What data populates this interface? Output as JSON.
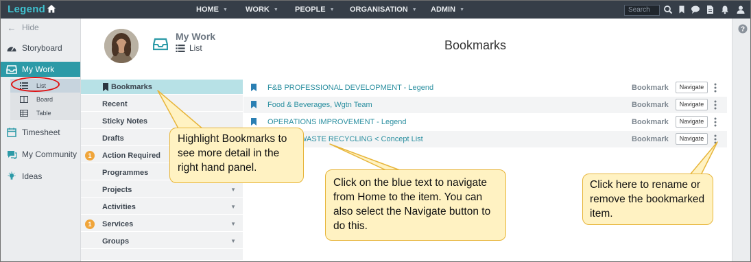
{
  "app": {
    "logo": "Legend"
  },
  "topnav": {
    "items": [
      {
        "label": "HOME"
      },
      {
        "label": "WORK"
      },
      {
        "label": "PEOPLE"
      },
      {
        "label": "ORGANISATION"
      },
      {
        "label": "ADMIN"
      }
    ],
    "search_placeholder": "Search"
  },
  "sidebar": {
    "hide_label": "Hide",
    "items": [
      {
        "label": "Storyboard",
        "icon": "dashboard-icon"
      },
      {
        "label": "My Work",
        "icon": "tray-icon"
      },
      {
        "label": "Timesheet",
        "icon": "calendar-icon"
      },
      {
        "label": "My Community",
        "icon": "chat-icon"
      },
      {
        "label": "Ideas",
        "icon": "lightbulb-icon"
      }
    ],
    "subitems": [
      {
        "label": "List",
        "icon": "list-icon"
      },
      {
        "label": "Board",
        "icon": "columns-icon"
      },
      {
        "label": "Table",
        "icon": "table-icon"
      }
    ]
  },
  "header": {
    "section_title": "My Work",
    "view_label": "List",
    "page_title": "Bookmarks"
  },
  "categories": [
    {
      "label": "Bookmarks",
      "count": "",
      "expandable": false
    },
    {
      "label": "Recent",
      "count": "",
      "expandable": false
    },
    {
      "label": "Sticky Notes",
      "count": "",
      "expandable": false
    },
    {
      "label": "Drafts",
      "count": "",
      "expandable": false
    },
    {
      "label": "Action Required",
      "count": "1",
      "expandable": false
    },
    {
      "label": "Programmes",
      "count": "",
      "expandable": true
    },
    {
      "label": "Projects",
      "count": "",
      "expandable": true
    },
    {
      "label": "Activities",
      "count": "",
      "expandable": true
    },
    {
      "label": "Services",
      "count": "1",
      "expandable": true
    },
    {
      "label": "Groups",
      "count": "",
      "expandable": true
    }
  ],
  "bookmarks": [
    {
      "title": "F&B PROFESSIONAL DEVELOPMENT - Legend",
      "type": "Bookmark",
      "button": "Navigate"
    },
    {
      "title": "Food & Beverages, Wgtn Team",
      "type": "Bookmark",
      "button": "Navigate"
    },
    {
      "title": "OPERATIONS IMPROVEMENT - Legend",
      "type": "Bookmark",
      "button": "Navigate"
    },
    {
      "title": "Concept: WASTE RECYCLING < Concept List",
      "type": "Bookmark",
      "button": "Navigate"
    }
  ],
  "callouts": {
    "highlight": "Highlight Bookmarks to see more detail in the right hand panel.",
    "navigate": "Click on the blue text to navigate from Home to the item.  You can also select the Navigate button to do this.",
    "rename": "Click here to rename or remove the bookmarked item."
  },
  "colors": {
    "topbar": "#363e48",
    "accent": "#2c9aa7",
    "link": "#2b8fa0",
    "selected_category": "#b7e1e6",
    "callout_fill": "#fff2c2",
    "callout_border": "#e7b53a",
    "annotation_ring": "#e01010",
    "count_badge": "#f0a53a"
  }
}
